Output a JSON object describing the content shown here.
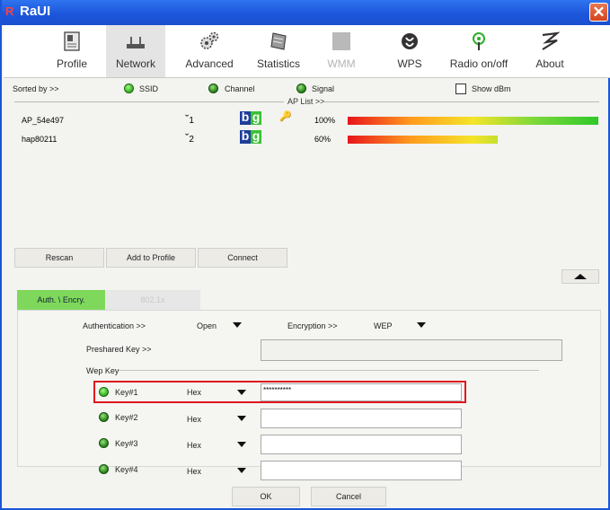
{
  "window": {
    "title": "RaUI",
    "app_icon": "R",
    "close": "✕"
  },
  "toolbar": [
    {
      "label": "Profile",
      "icon": "profile-icon"
    },
    {
      "label": "Network",
      "icon": "network-icon",
      "active": true
    },
    {
      "label": "Advanced",
      "icon": "gears-icon"
    },
    {
      "label": "Statistics",
      "icon": "statistics-icon"
    },
    {
      "label": "WMM",
      "icon": "wmm-icon",
      "disabled": true
    },
    {
      "label": "WPS",
      "icon": "wps-icon"
    },
    {
      "label": "Radio on/off",
      "icon": "radio-icon"
    },
    {
      "label": "About",
      "icon": "about-icon"
    }
  ],
  "sort": {
    "label": "Sorted by >>",
    "ssid": "SSID",
    "channel": "Channel",
    "signal": "Signal",
    "show_dbm": "Show dBm",
    "ap_list": "AP List >>"
  },
  "aps": [
    {
      "ssid": "AP_54e497",
      "channel": "1",
      "signal": "100%",
      "signal_fraction": 1.0,
      "secured": true
    },
    {
      "ssid": "hap80211",
      "channel": "2",
      "signal": "60%",
      "signal_fraction": 0.6,
      "secured": false
    }
  ],
  "ap_mode_icon": {
    "b": "b",
    "g": "g"
  },
  "actions": {
    "rescan": "Rescan",
    "add_to_profile": "Add to Profile",
    "connect": "Connect"
  },
  "tabs": {
    "auth": "Auth. \\ Encry.",
    "dot1x": "802.1x"
  },
  "auth": {
    "auth_label": "Authentication >>",
    "auth_value": "Open",
    "enc_label": "Encryption >>",
    "enc_value": "WEP",
    "psk_label": "Preshared Key >>",
    "wep_key_label": "Wep Key"
  },
  "keys": [
    {
      "label": "Key#1",
      "format": "Hex",
      "value": "**********",
      "selected": true
    },
    {
      "label": "Key#2",
      "format": "Hex",
      "value": "",
      "selected": false
    },
    {
      "label": "Key#3",
      "format": "Hex",
      "value": "",
      "selected": false
    },
    {
      "label": "Key#4",
      "format": "Hex",
      "value": "",
      "selected": false
    }
  ],
  "footer": {
    "ok": "OK",
    "cancel": "Cancel"
  },
  "colors": {
    "title_bar": "#1d56db",
    "highlight_box": "#e0161c",
    "active_tab": "#7fd85c"
  }
}
